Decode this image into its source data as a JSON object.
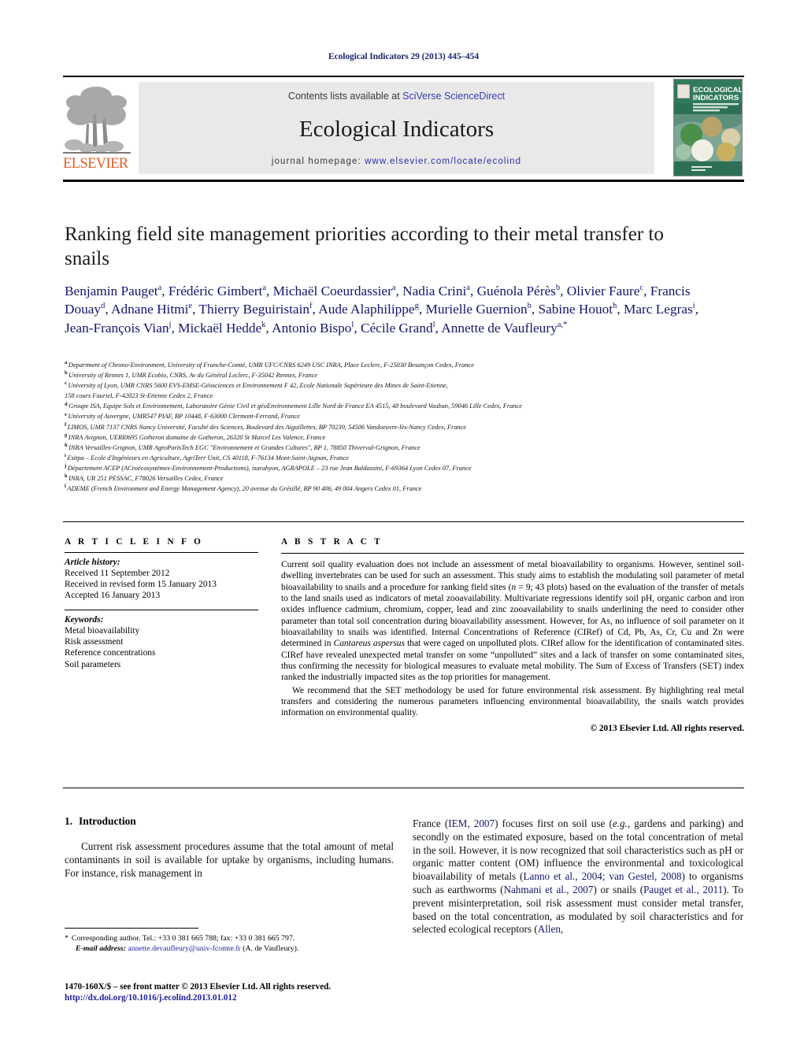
{
  "running_head": "Ecological Indicators 29 (2013) 445–454",
  "masthead": {
    "contents_prefix": "Contents lists available at ",
    "contents_link": "SciVerse ScienceDirect",
    "journal_name": "Ecological Indicators",
    "homepage_prefix": "journal homepage: ",
    "homepage_url": "www.elsevier.com/locate/ecolind",
    "publisher_logo_text": "ELSEVIER",
    "cover_title_line1": "ECOLOGICAL",
    "cover_title_line2": "INDICATORS",
    "accent_link_color": "#3b3bb0",
    "publisher_color": "#E25D24"
  },
  "article": {
    "title": "Ranking field site management priorities according to their metal transfer to snails",
    "authors_html": "Benjamin Pauget<sup>a</sup>, Frédéric Gimbert<sup>a</sup>, Michaël Coeurdassier<sup>a</sup>, Nadia Crini<sup>a</sup>, Guénola Pérès<sup>b</sup>, Olivier Faure<sup>c</sup>, Francis Douay<sup>d</sup>, Adnane Hitmi<sup>e</sup>, Thierry Beguiristain<sup>f</sup>, Aude Alaphilippe<sup>g</sup>, Murielle Guernion<sup>b</sup>, Sabine Houot<sup>h</sup>, Marc Legras<sup>i</sup>, Jean-François Vian<sup>j</sup>, Mickaël Hedde<sup>k</sup>, Antonio Bispo<sup>l</sup>, Cécile Grand<sup>l</sup>, Annette de Vaufleury<sup>a,</sup><sup>*</sup>",
    "affiliations": [
      {
        "label": "a",
        "text": "Department of Chrono-Environment, University of Franche-Comté, UMR UFC/CNRS 6249 USC INRA, Place Leclerc, F-25030 Besançon Cedex, France"
      },
      {
        "label": "b",
        "text": "University of Rennes 1, UMR Ecobio, CNRS, Av du Général Leclerc, F-35042 Rennes, France"
      },
      {
        "label": "c",
        "text": "University of Lyon, UMR CNRS 5600 EVS-EMSE-Géosciences et Environnement F 42, Ecole Nationale Supérieure des Mines de Saint-Etienne,"
      },
      {
        "label": "",
        "text": "158 cours Fauriel, F-42023 St-Etienne Cedex 2, France"
      },
      {
        "label": "d",
        "text": "Groupe ISA, Equipe Sols et Environnement, Laboratoire Génie Civil et géoEnvironnement Lille Nord de France EA 4515, 48 boulevard Vauban, 59046 Lille Cedex, France"
      },
      {
        "label": "e",
        "text": "University of Auvergne, UMR547 PIAF, BP 10448, F-63000 Clermont-Ferrand, France"
      },
      {
        "label": "f",
        "text": "LIMOS, UMR 7137 CNRS Nancy Université, Faculté des Sciences, Boulevard des Aiguillettes, BP 70239, 54506 Vandoeuvre-lès-Nancy Cedex, France"
      },
      {
        "label": "g",
        "text": "INRA Avignon, UERI0695 Gotheron domaine de Gotheron, 26320 St Marcel Les Valence, France"
      },
      {
        "label": "h",
        "text": "INRA Versailles-Grignon, UMR AgroParisTech EGC \"Environnement et Grandes Cultures\", BP 1, 78850 Thiverval-Grignon, France"
      },
      {
        "label": "i",
        "text": "Esitpa – Ecole d'Ingénieurs en Agriculture, AgriTerr Unit, CS 40118, F-76134 Mont-Saint-Aignan, France"
      },
      {
        "label": "j",
        "text": "Département ACEP (ACroécosystèmes-Environnement-Productions), isarahyon, AGRAPOLE – 23 rue Jean Baldassini, F-69364 Lyon Cedex 07, France"
      },
      {
        "label": "k",
        "text": "INRA, UR 251 PESSAC, F78026 Versailles Cedex, France"
      },
      {
        "label": "l",
        "text": "ADEME (French Environment and Energy Management Agency), 20 avenue du Grésillé, BP 90 406, 49 004 Angers Cedex 01, France"
      }
    ]
  },
  "article_info": {
    "heading": "A R T I C L E   I N F O",
    "history_label": "Article history:",
    "history": [
      "Received 11 September 2012",
      "Received in revised form 15 January 2013",
      "Accepted 16 January 2013"
    ],
    "keywords_label": "Keywords:",
    "keywords": [
      "Metal bioavailability",
      "Risk assessment",
      "Reference concentrations",
      "Soil parameters"
    ]
  },
  "abstract": {
    "heading": "A B S T R A C T",
    "paragraph_1_html": "Current soil quality evaluation does not include an assessment of metal bioavailability to organisms. However, sentinel soil-dwelling invertebrates can be used for such an assessment. This study aims to establish the modulating soil parameter of metal bioavailability to snails and a procedure for ranking field sites (<span class=\"ital\">n</span> = 9; 43 plots) based on the evaluation of the transfer of metals to the land snails used as indicators of metal zooavailability. Multivariate regressions identify soil pH, organic carbon and iron oxides influence cadmium, chromium, copper, lead and zinc zooavailability to snails underlining the need to consider other parameter than total soil concentration during bioavailability assessment. However, for As, no influence of soil parameter on it bioavailability to snails was identified. Internal Concentrations of Reference (CIRef) of Cd, Pb, As, Cr, Cu and Zn were determined in <span class=\"ital\">Cantareus aspersus</span> that were caged on unpolluted plots. CIRef allow for the identification of contaminated sites. CIRef have revealed unexpected metal transfer on some &ldquo;unpolluted&rdquo; sites and a lack of transfer on some contaminated sites, thus confirming the necessity for biological measures to evaluate metal mobility. The Sum of Excess of Transfers (SET) index ranked the industrially impacted sites as the top priorities for management.",
    "paragraph_2_html": "We recommend that the SET methodology be used for future environmental risk assessment. By highlighting real metal transfers and considering the numerous parameters influencing environmental bioavailability, the snails watch provides information on environmental quality.",
    "copyright": "© 2013 Elsevier Ltd. All rights reserved."
  },
  "body": {
    "section_number": "1.",
    "section_title": "Introduction",
    "left_paragraph_html": "Current risk assessment procedures assume that the total amount of metal contaminants in soil is available for uptake by organisms, including humans. For instance, risk management in",
    "right_paragraph_html": "France (<span class=\"cit\">IEM, 2007</span>) focuses first on soil use (<span class=\"ital\">e.g.</span>, gardens and parking) and secondly on the estimated exposure, based on the total concentration of metal in the soil. However, it is now recognized that soil characteristics such as pH or organic matter content (OM) influence the environmental and toxicological bioavailability of metals (<span class=\"cit\">Lanno et al., 2004; van Gestel, 2008</span>) to organisms such as earthworms (<span class=\"cit\">Nahmani et al., 2007</span>) or snails (<span class=\"cit\">Pauget et al., 2011</span>). To prevent misinterpretation, soil risk assessment must consider metal transfer, based on the total concentration, as modulated by soil characteristics and for selected ecological receptors (<span class=\"cit\">Allen,</span>"
  },
  "footer": {
    "corresponding_marker": "*",
    "corresponding_text": "Corresponding author. Tel.: +33 0 381 665 788; fax: +33 0 381 665 797.",
    "email_label": "E-mail address:",
    "email": "annette.devaufleury@univ-fcomte.fr",
    "email_suffix": "(A. de Vaufleury).",
    "issn_line": "1470-160X/$ – see front matter © 2013 Elsevier Ltd. All rights reserved.",
    "doi": "http://dx.doi.org/10.1016/j.ecolind.2013.01.012"
  }
}
